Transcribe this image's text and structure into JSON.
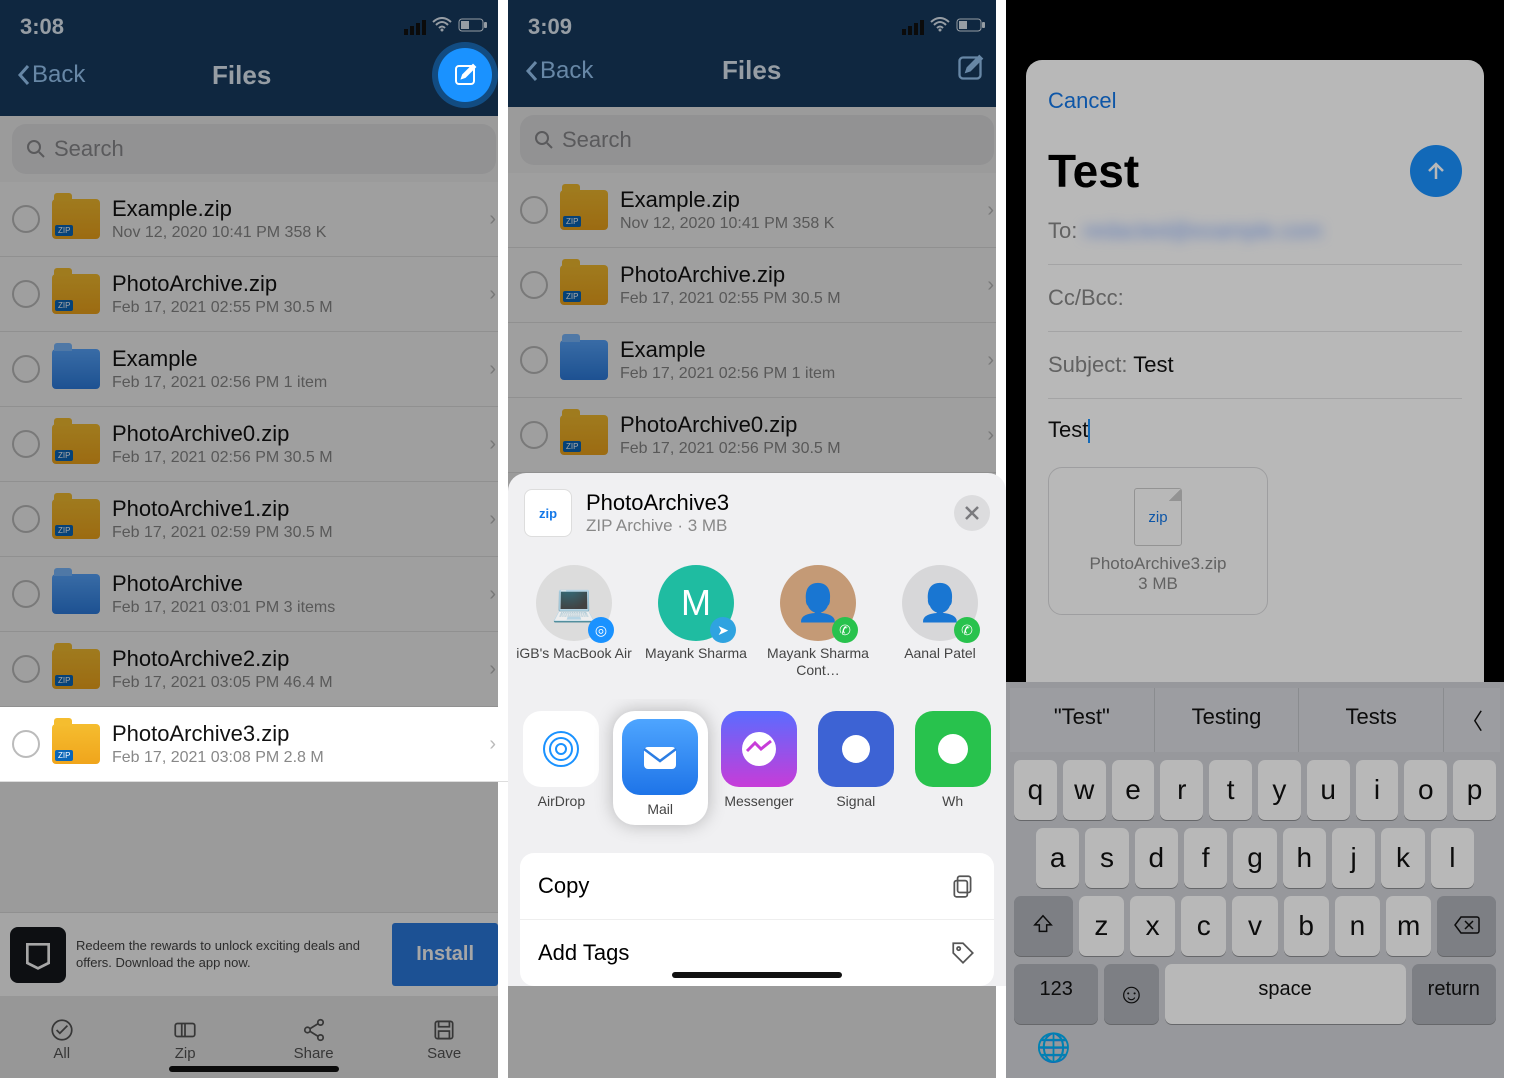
{
  "panel1": {
    "time": "3:08",
    "nav": {
      "back": "Back",
      "title": "Files"
    },
    "search_placeholder": "Search",
    "files": [
      {
        "name": "Example.zip",
        "sub": "Nov 12, 2020 10:41 PM   358 K",
        "type": "zip"
      },
      {
        "name": "PhotoArchive.zip",
        "sub": "Feb 17, 2021 02:55 PM   30.5 M",
        "type": "zip"
      },
      {
        "name": "Example",
        "sub": "Feb 17, 2021 02:56 PM   1 item",
        "type": "folder"
      },
      {
        "name": "PhotoArchive0.zip",
        "sub": "Feb 17, 2021 02:56 PM   30.5 M",
        "type": "zip"
      },
      {
        "name": "PhotoArchive1.zip",
        "sub": "Feb 17, 2021 02:59 PM   30.5 M",
        "type": "zip"
      },
      {
        "name": "PhotoArchive",
        "sub": "Feb 17, 2021 03:01 PM   3 items",
        "type": "folder"
      },
      {
        "name": "PhotoArchive2.zip",
        "sub": "Feb 17, 2021 03:05 PM   46.4 M",
        "type": "zip"
      },
      {
        "name": "PhotoArchive3.zip",
        "sub": "Feb 17, 2021 03:08 PM   2.8 M",
        "type": "zip",
        "highlight": true
      }
    ],
    "ad": {
      "text": "Redeem the rewards to unlock exciting deals and offers. Download the app now.",
      "cta": "Install"
    },
    "tabs": [
      "All",
      "Zip",
      "Share",
      "Save"
    ]
  },
  "panel2": {
    "time": "3:09",
    "nav": {
      "back": "Back",
      "title": "Files"
    },
    "search_placeholder": "Search",
    "share": {
      "title": "PhotoArchive3",
      "sub": "ZIP Archive · 3 MB",
      "contacts": [
        {
          "name": "iGB's MacBook Air",
          "badge": "airdrop",
          "color": "#dcdcdc"
        },
        {
          "name": "Mayank Sharma",
          "initial": "M",
          "badge": "telegram",
          "color": "#1fbca1"
        },
        {
          "name": "Mayank Sharma Cont…",
          "badge": "whatsapp",
          "color": "#c49a76"
        },
        {
          "name": "Aanal Patel",
          "badge": "whatsapp",
          "color": "#d7d7d9"
        }
      ],
      "apps": [
        {
          "name": "AirDrop",
          "id": "airdrop"
        },
        {
          "name": "Mail",
          "id": "mail",
          "highlight": true
        },
        {
          "name": "Messenger",
          "id": "messenger"
        },
        {
          "name": "Signal",
          "id": "signal"
        },
        {
          "name": "Wh",
          "id": "whatsapp"
        }
      ],
      "actions": [
        "Copy",
        "Add Tags"
      ]
    }
  },
  "panel3": {
    "cancel": "Cancel",
    "title": "Test",
    "to_label": "To:",
    "to_value": "redacted@example.com",
    "ccbcc": "Cc/Bcc:",
    "subject_label": "Subject:",
    "subject_value": "Test",
    "body": "Test",
    "attachment": {
      "ext": "zip",
      "name": "PhotoArchive3.zip",
      "size": "3 MB"
    },
    "suggestions": [
      "\"Test\"",
      "Testing",
      "Tests"
    ],
    "keys": {
      "r1": [
        "q",
        "w",
        "e",
        "r",
        "t",
        "y",
        "u",
        "i",
        "o",
        "p"
      ],
      "r2": [
        "a",
        "s",
        "d",
        "f",
        "g",
        "h",
        "j",
        "k",
        "l"
      ],
      "r3": [
        "z",
        "x",
        "c",
        "v",
        "b",
        "n",
        "m"
      ],
      "num": "123",
      "space": "space",
      "ret": "return"
    }
  }
}
